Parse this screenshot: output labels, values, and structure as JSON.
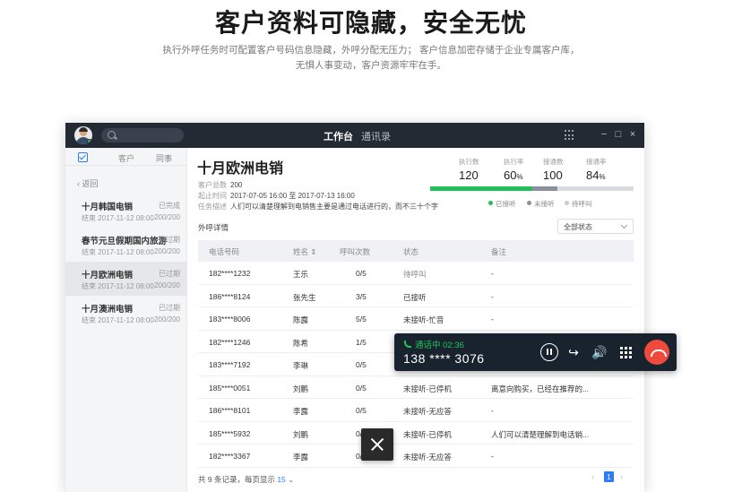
{
  "hero": {
    "title": "客户资料可隐藏，安全无忧",
    "desc_line1": "执行外呼任务时可配置客户号码信息隐藏，外呼分配无压力； 客户信息加密存储于企业专属客户库，",
    "desc_line2": "无惧人事变动，客户资源牢牢在手。"
  },
  "topbar": {
    "avatar_icon": "user-avatar",
    "search_icon": "search-icon",
    "tabs": [
      {
        "label": "工作台",
        "active": true
      },
      {
        "label": "通讯录",
        "active": false
      }
    ],
    "grid_icon": "grid-icon",
    "window_controls": [
      "−",
      "□",
      "×"
    ]
  },
  "sidebar": {
    "tabs": [
      "客户",
      "同事"
    ],
    "back_label": "返回",
    "items": [
      {
        "name": "十月韩国电销",
        "status": "已完成",
        "meta": "结束  2017-11-12 08:00",
        "count": "200/200",
        "active": false
      },
      {
        "name": "春节元旦假期国内旅游",
        "status": "已过期",
        "meta": "结束  2017-11-12 08:00",
        "count": "200/200",
        "active": false
      },
      {
        "name": "十月欧洲电销",
        "status": "已过期",
        "meta": "结束  2017-11-12 08:00",
        "count": "200/200",
        "active": true
      },
      {
        "name": "十月澳洲电销",
        "status": "已过期",
        "meta": "结束  2017-11-12 08:00",
        "count": "200/200",
        "active": false
      }
    ]
  },
  "task": {
    "title": "十月欧洲电销",
    "total_label": "客户总数",
    "total_value": "200",
    "period_label": "起止时间",
    "period_value": "2017-07-05 16:00 至 2017-07-13 16:00",
    "desc_label": "任务描述",
    "desc_value": "人们可以清楚理解到电销售主要是通过电话进行的，而不三十个字"
  },
  "stats": [
    {
      "label": "执行数",
      "value": "120",
      "unit": ""
    },
    {
      "label": "执行率",
      "value": "60",
      "unit": "%"
    },
    {
      "label": "接通数",
      "value": "100",
      "unit": ""
    },
    {
      "label": "接通率",
      "value": "84",
      "unit": "%"
    }
  ],
  "progress": {
    "segments": [
      {
        "name": "已接听",
        "fraction": 0.5,
        "color": "#21c05a"
      },
      {
        "name": "未接听",
        "fraction": 0.125,
        "color": "#8a919c"
      },
      {
        "name": "待呼叫",
        "fraction": 0.375,
        "color": "#d9dbe0"
      }
    ],
    "legend": [
      "已接听",
      "未接听",
      "待呼叫"
    ]
  },
  "list": {
    "section_title": "外呼详情",
    "filter_value": "全部状态",
    "columns": [
      "电话号码",
      "姓名 ⇕",
      "呼叫次数",
      "状态",
      "备注"
    ],
    "rows": [
      {
        "phone": "182****1232",
        "name": "王乐",
        "calls": "0/5",
        "status": "待呼叫",
        "note": "-"
      },
      {
        "phone": "186****8124",
        "name": "张先生",
        "calls": "3/5",
        "status": "已接听",
        "note": "-"
      },
      {
        "phone": "183****8006",
        "name": "陈露",
        "calls": "5/5",
        "status": "未接听-忙音",
        "note": "-"
      },
      {
        "phone": "182****1246",
        "name": "陈希",
        "calls": "1/5",
        "status": "",
        "note": ""
      },
      {
        "phone": "183****7192",
        "name": "李琳",
        "calls": "0/5",
        "status": "",
        "note": ""
      },
      {
        "phone": "185****0051",
        "name": "刘鹏",
        "calls": "0/5",
        "status": "未接听-已停机",
        "note": "离意向购买，已经在推荐的..."
      },
      {
        "phone": "186****8101",
        "name": "李露",
        "calls": "0/5",
        "status": "未接听-无应答",
        "note": "-"
      },
      {
        "phone": "185****5932",
        "name": "刘鹏",
        "calls": "0/",
        "status": "未接听-已停机",
        "note": "人们可以清楚理解到电话销..."
      },
      {
        "phone": "182****3367",
        "name": "李露",
        "calls": "0/",
        "status": "未接听-无应答",
        "note": "-"
      }
    ],
    "footer_prefix": "共 9 条记录，每页显示",
    "page_size": "15",
    "current_page": "1"
  },
  "callbar": {
    "status": "通话中 02:36",
    "number": "138 **** 3076",
    "status_color": "#22c35b",
    "hangup_color": "#f04a3c"
  }
}
